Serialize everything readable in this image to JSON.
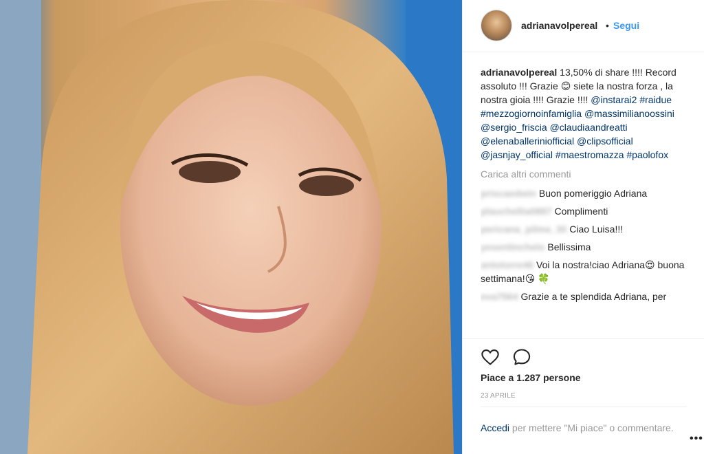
{
  "post": {
    "username": "adrianavolpereal",
    "separator": "•",
    "follow_label": "Segui",
    "caption": {
      "author": "adrianavolpereal",
      "text": "13,50% di share !!!! Record assoluto !!! Grazie 😊 siete la nostra forza , la nostra gioia !!!! Grazie !!!!",
      "tags": [
        "@instarai2",
        "#raidue",
        "#mezzogiornoinfamiglia",
        "@massimilianoossini",
        "@sergio_friscia",
        "@claudiaandreatti",
        "@elenaballeriniofficial",
        "@clipsofficial",
        "@jasnjay_official",
        "#maestromazza",
        "#paolofox"
      ]
    },
    "load_more_label": "Carica altri commenti",
    "comments": [
      {
        "user": "priscaedwin",
        "text": "Buon pomeriggio Adriana"
      },
      {
        "user": "plauchellia0887",
        "text": "Complimenti"
      },
      {
        "user": "pericana_pilma_30",
        "text": "Ciao Luisa!!!"
      },
      {
        "user": "yesentinchelo",
        "text": "Bellissima"
      },
      {
        "user": "antotorre46",
        "text": "Voi la nostra!ciao Adriana😍 buona settimana!😘 🍀"
      },
      {
        "user": "eva7564",
        "text": "Grazie a te splendida Adriana, per"
      }
    ],
    "likes_label": "Piace a 1.287 persone",
    "date_label": "23 APRILE",
    "login_link": "Accedi",
    "login_text": "per mettere \"Mi piace\" o commentare.",
    "more_label": "•••"
  },
  "icons": {
    "like": "heart-outline-icon",
    "comment": "speech-bubble-icon"
  }
}
